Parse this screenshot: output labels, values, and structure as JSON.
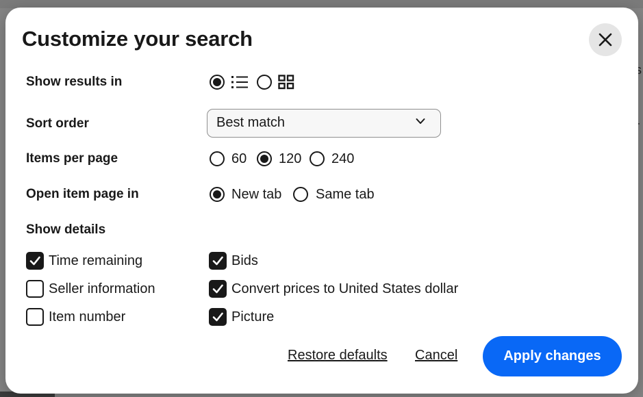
{
  "dialog": {
    "title": "Customize your search",
    "close_icon": "close-icon"
  },
  "background": {
    "edge_glyph_top": "s",
    "edge_glyph_mid": "r"
  },
  "view": {
    "label": "Show results in",
    "options": [
      {
        "icon": "list-view-icon",
        "selected": true
      },
      {
        "icon": "grid-view-icon",
        "selected": false
      }
    ]
  },
  "sort": {
    "label": "Sort order",
    "selected": "Best match",
    "icon": "chevron-down-icon"
  },
  "per_page": {
    "label": "Items per page",
    "options": [
      {
        "label": "60",
        "selected": false
      },
      {
        "label": "120",
        "selected": true
      },
      {
        "label": "240",
        "selected": false
      }
    ]
  },
  "open_in": {
    "label": "Open item page in",
    "options": [
      {
        "label": "New tab",
        "selected": true
      },
      {
        "label": "Same tab",
        "selected": false
      }
    ]
  },
  "details": {
    "label": "Show details",
    "items": [
      {
        "label": "Time remaining",
        "checked": true
      },
      {
        "label": "Seller information",
        "checked": false
      },
      {
        "label": "Item number",
        "checked": false
      },
      {
        "label": "Bids",
        "checked": true
      },
      {
        "label": "Convert prices to United States dollar",
        "checked": true
      },
      {
        "label": "Picture",
        "checked": true
      }
    ]
  },
  "footer": {
    "restore_label": "Restore defaults",
    "cancel_label": "Cancel",
    "apply_label": "Apply changes"
  },
  "colors": {
    "accent": "#0968f6",
    "text": "#191919",
    "close_bg": "#e5e5e5"
  }
}
